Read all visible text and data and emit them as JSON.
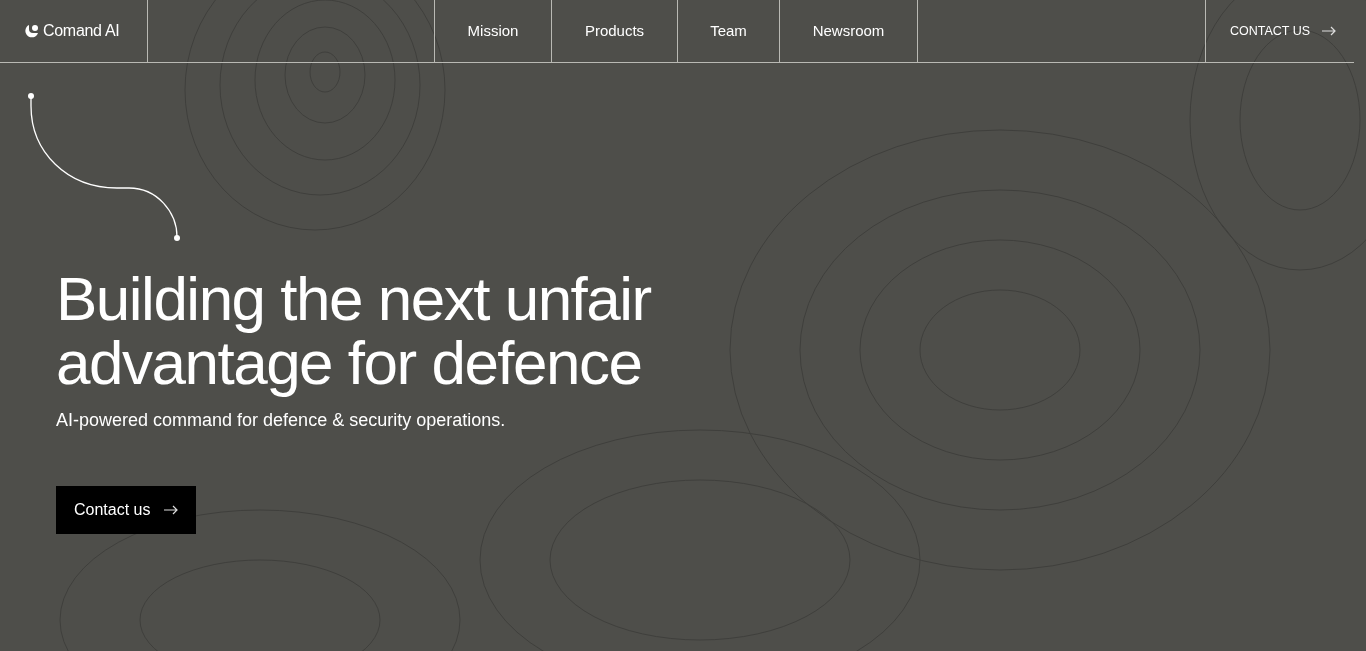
{
  "header": {
    "logo": "Comand AI",
    "nav": [
      {
        "label": "Mission"
      },
      {
        "label": "Products"
      },
      {
        "label": "Team"
      },
      {
        "label": "Newsroom"
      }
    ],
    "contact": "CONTACT US"
  },
  "hero": {
    "headline": [
      "Building the next unfair",
      "advantage for defence"
    ],
    "subtitle": "AI-powered command for defence & security operations.",
    "button": "Contact us"
  }
}
